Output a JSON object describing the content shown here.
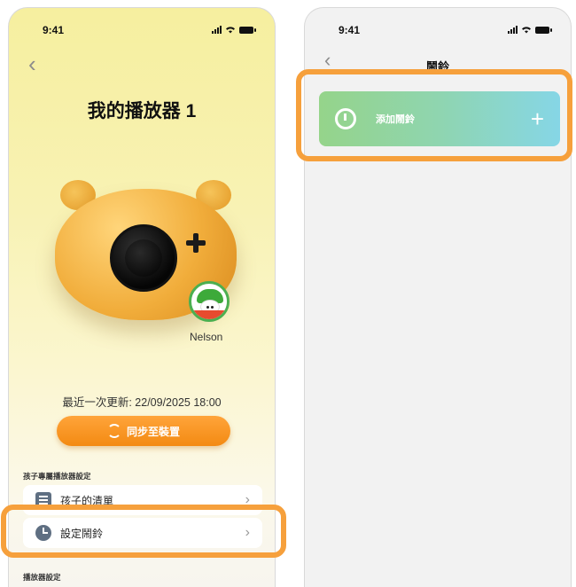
{
  "left_screen": {
    "status_time": "9:41",
    "page_title": "我的播放器 1",
    "child_name": "Nelson",
    "last_updated": "最近一次更新: 22/09/2025  18:00",
    "sync_button": "同步至裝置",
    "section_child": "孩子專屬播放器設定",
    "menu_items": [
      {
        "label": "孩子的清單",
        "icon": "list-icon"
      },
      {
        "label": "設定鬧鈴",
        "icon": "clock-icon"
      }
    ],
    "section_player": "播放器設定"
  },
  "right_screen": {
    "status_time": "9:41",
    "page_title": "鬧鈴",
    "add_alarm_label": "添加鬧鈴"
  },
  "colors": {
    "highlight": "#f6a03c",
    "sync_button": "#f38a12",
    "alarm_gradient_start": "#95d48a",
    "alarm_gradient_end": "#86d6e6"
  }
}
